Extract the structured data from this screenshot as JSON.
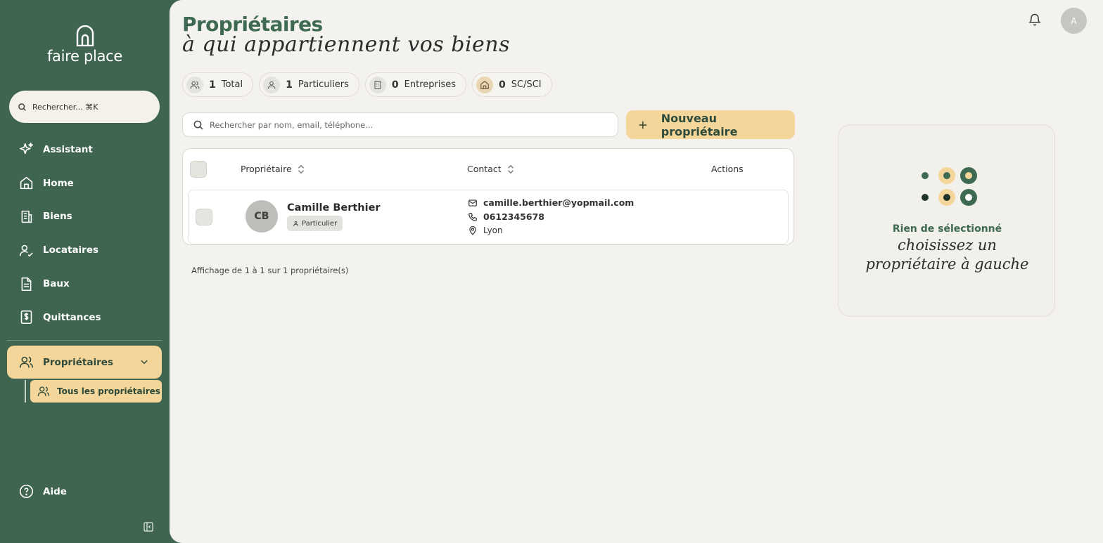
{
  "brand": {
    "name": "faire place",
    "logo_icon": "house-arch-icon"
  },
  "sidebar": {
    "search_placeholder": "Rechercher... ⌘K",
    "items": [
      {
        "label": "Assistant",
        "icon": "sparkles-icon"
      },
      {
        "label": "Home",
        "icon": "home-icon"
      },
      {
        "label": "Biens",
        "icon": "building-icon"
      },
      {
        "label": "Locataires",
        "icon": "user-check-icon"
      },
      {
        "label": "Baux",
        "icon": "document-icon"
      },
      {
        "label": "Quittances",
        "icon": "receipt-icon"
      }
    ],
    "active": {
      "label": "Propriétaires",
      "icon": "users-icon"
    },
    "sub_active": {
      "label": "Tous les propriétaires",
      "icon": "users-icon"
    },
    "help_label": "Aide"
  },
  "header": {
    "title": "Propriétaires",
    "subtitle": "à qui appartiennent vos biens",
    "avatar_initial": "A"
  },
  "stats": [
    {
      "value": "1",
      "label": "Total",
      "icon": "users-icon"
    },
    {
      "value": "1",
      "label": "Particuliers",
      "icon": "user-icon"
    },
    {
      "value": "0",
      "label": "Entreprises",
      "icon": "building-icon"
    },
    {
      "value": "0",
      "label": "SC/SCI",
      "icon": "home-icon"
    }
  ],
  "search": {
    "placeholder": "Rechercher par nom, email, téléphone..."
  },
  "new_button": {
    "label": "Nouveau propriétaire"
  },
  "table": {
    "columns": {
      "owner": "Propriétaire",
      "contact": "Contact",
      "actions": "Actions"
    },
    "rows": [
      {
        "initials": "CB",
        "name": "Camille Berthier",
        "type": "Particulier",
        "email": "camille.berthier@yopmail.com",
        "phone": "0612345678",
        "city": "Lyon"
      }
    ]
  },
  "pagination": {
    "text": "Affichage de 1 à 1 sur 1 propriétaire(s)"
  },
  "empty_state": {
    "title": "Rien de sélectionné",
    "subtitle_line1": "choisissez un",
    "subtitle_line2": "propriétaire à gauche"
  },
  "colors": {
    "sidebar": "#3f6550",
    "accent": "#f5d69a",
    "title": "#3d6a50",
    "background": "#f4f2ee"
  }
}
